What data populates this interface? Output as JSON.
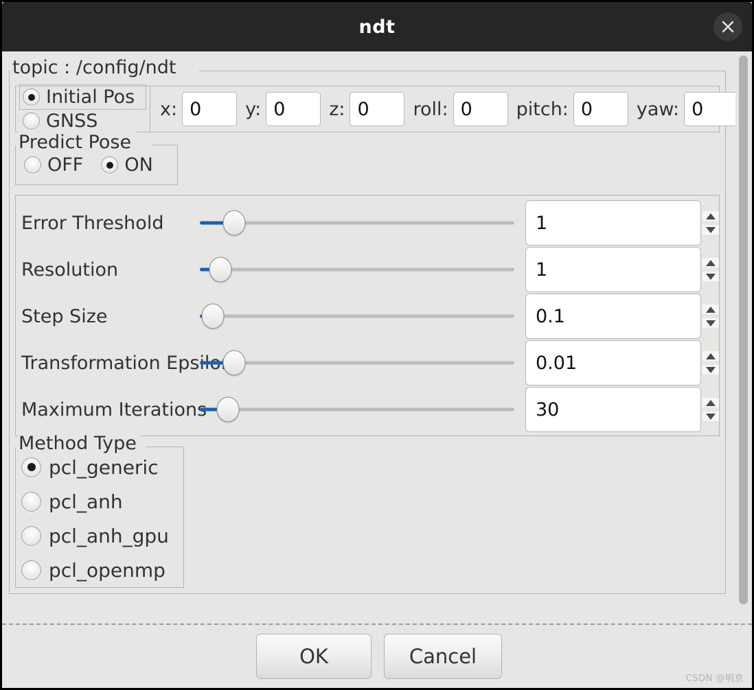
{
  "window": {
    "title": "ndt",
    "close_icon": "close-icon"
  },
  "topic": {
    "label": "topic : /config/ndt"
  },
  "pose": {
    "mode_options": [
      {
        "label": "Initial Pos",
        "checked": true
      },
      {
        "label": "GNSS",
        "checked": false
      }
    ],
    "fields": [
      {
        "label": "x:",
        "value": "0"
      },
      {
        "label": "y:",
        "value": "0"
      },
      {
        "label": "z:",
        "value": "0"
      },
      {
        "label": "roll:",
        "value": "0"
      },
      {
        "label": "pitch:",
        "value": "0"
      },
      {
        "label": "yaw:",
        "value": "0"
      }
    ]
  },
  "predict_pose": {
    "label": "Predict Pose",
    "options": [
      {
        "label": "OFF",
        "checked": false
      },
      {
        "label": "ON",
        "checked": true
      }
    ]
  },
  "sliders": [
    {
      "label": "Error Threshold",
      "value": "1",
      "handle_pct": 6.5,
      "up_icon": "arrow-up-icon",
      "down_icon": "arrow-down-icon"
    },
    {
      "label": "Resolution",
      "value": "1",
      "handle_pct": 4.0,
      "up_icon": "arrow-up-icon",
      "down_icon": "arrow-down-icon"
    },
    {
      "label": "Step Size",
      "value": "0.1",
      "handle_pct": 1.2,
      "up_icon": "arrow-up-icon",
      "down_icon": "arrow-down-icon"
    },
    {
      "label": "Transformation Epsilon",
      "value": "0.01",
      "handle_pct": 1.2,
      "up_icon": "arrow-up-icon",
      "down_icon": "arrow-down-icon"
    },
    {
      "label": "Maximum Iterations",
      "value": "30",
      "handle_pct": 1.2,
      "up_icon": "arrow-up-icon",
      "down_icon": "arrow-down-icon"
    }
  ],
  "method_type": {
    "label": "Method Type",
    "options": [
      {
        "label": "pcl_generic",
        "checked": true
      },
      {
        "label": "pcl_anh",
        "checked": false
      },
      {
        "label": "pcl_anh_gpu",
        "checked": false
      },
      {
        "label": "pcl_openmp",
        "checked": false
      }
    ]
  },
  "footer": {
    "ok_label": "OK",
    "cancel_label": "Cancel",
    "watermark": "CSDN @明京"
  },
  "colors": {
    "accent": "#1a5fb4",
    "background": "#e6e6e4",
    "titlebar": "#262626",
    "text": "#2e3436"
  }
}
